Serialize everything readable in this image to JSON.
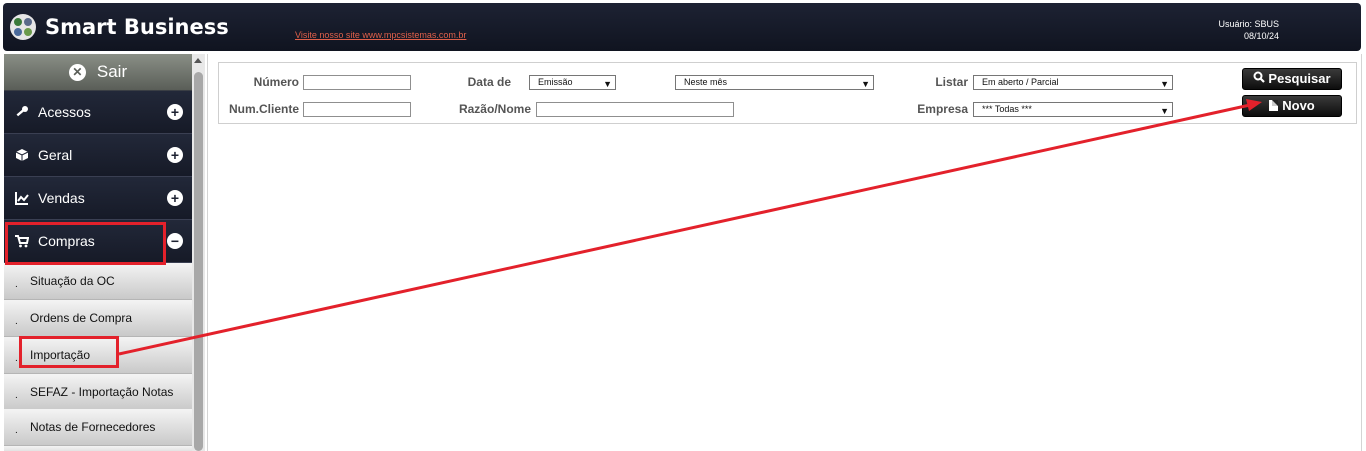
{
  "header": {
    "app_title": "Smart Business",
    "site_link": "Visite nosso site www.mpcsistemas.com.br",
    "user_label": "Usuário: SBUS",
    "date": "08/10/24"
  },
  "sidebar": {
    "sair_label": "Sair",
    "menu": [
      {
        "label": "Acessos",
        "icon": "key-icon",
        "toggle": "+"
      },
      {
        "label": "Geral",
        "icon": "cube-icon",
        "toggle": "+"
      },
      {
        "label": "Vendas",
        "icon": "chart-icon",
        "toggle": "+"
      },
      {
        "label": "Compras",
        "icon": "cart-icon",
        "toggle": "−"
      }
    ],
    "submenu": [
      {
        "label": "Situação da OC"
      },
      {
        "label": "Ordens de Compra"
      },
      {
        "label": "Importação"
      },
      {
        "label": "SEFAZ - Importação Notas"
      },
      {
        "label": "Notas de Fornecedores"
      }
    ]
  },
  "filters": {
    "numero_label": "Número",
    "numero_value": "",
    "num_cliente_label": "Num.Cliente",
    "num_cliente_value": "",
    "data_de_label": "Data de",
    "data_de_value": "Emissão",
    "periodo_value": "Neste mês",
    "razao_label": "Razão/Nome",
    "razao_value": "",
    "listar_label": "Listar",
    "listar_value": "Em aberto / Parcial",
    "empresa_label": "Empresa",
    "empresa_value": "*** Todas ***"
  },
  "buttons": {
    "pesquisar": "Pesquisar",
    "novo": "Novo"
  },
  "colors": {
    "header_bg": "#161a27",
    "annotation": "#e3212b",
    "link": "#e0604a"
  }
}
